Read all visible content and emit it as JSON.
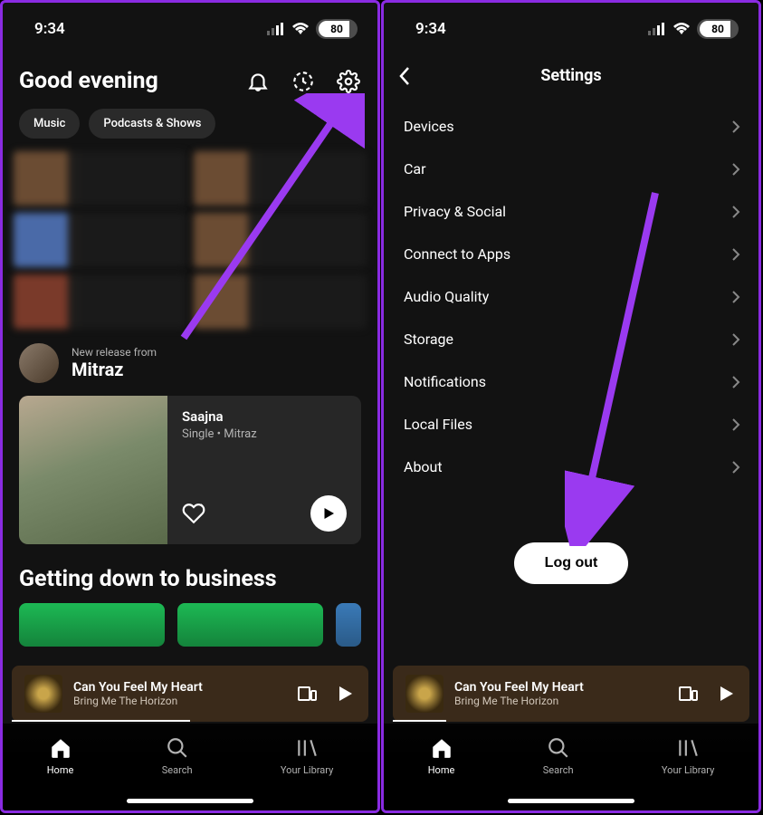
{
  "status": {
    "time": "9:34",
    "battery": "80"
  },
  "home": {
    "greeting": "Good evening",
    "chips": [
      "Music",
      "Podcasts & Shows"
    ],
    "release": {
      "from": "New release from",
      "artist": "Mitraz",
      "track_title": "Saajna",
      "track_sub": "Single • Mitraz"
    },
    "section2": "Getting down to business"
  },
  "settings": {
    "title": "Settings",
    "items": [
      "Devices",
      "Car",
      "Privacy & Social",
      "Connect to Apps",
      "Audio Quality",
      "Storage",
      "Notifications",
      "Local Files",
      "About"
    ],
    "logout": "Log out"
  },
  "now_playing": {
    "title": "Can You Feel My Heart",
    "artist": "Bring Me The Horizon"
  },
  "nav": {
    "home": "Home",
    "search": "Search",
    "library": "Your Library"
  }
}
